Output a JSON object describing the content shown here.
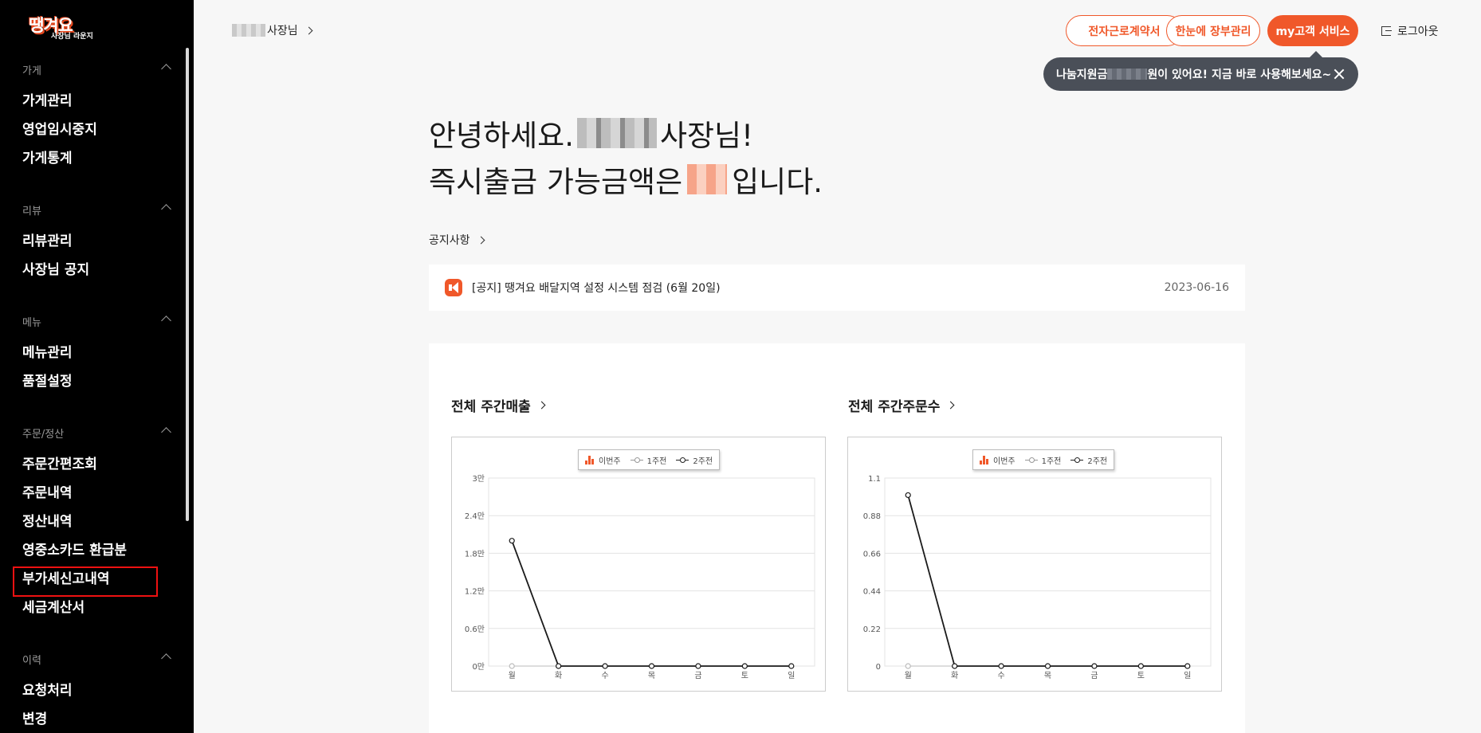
{
  "logo": {
    "main": "땡겨요",
    "sub": "사장님 라운지"
  },
  "sidebar": {
    "sections": [
      {
        "label": "가게",
        "items": [
          "가게관리",
          "영업임시중지",
          "가게통계"
        ]
      },
      {
        "label": "리뷰",
        "items": [
          "리뷰관리",
          "사장님 공지"
        ]
      },
      {
        "label": "메뉴",
        "items": [
          "메뉴관리",
          "품절설정"
        ]
      },
      {
        "label": "주문/정산",
        "items": [
          "주문간편조회",
          "주문내역",
          "정산내역",
          "영중소카드 환급분",
          "부가세신고내역",
          "세금계산서"
        ]
      },
      {
        "label": "이력",
        "items": [
          "요청처리",
          "변경"
        ]
      }
    ]
  },
  "header": {
    "owner_suffix": "사장님",
    "buttons": [
      "전자근로계약서",
      "한눈에 장부관리",
      "my고객 서비스"
    ],
    "logout": "로그아웃",
    "tooltip_prefix": "나눔지원금",
    "tooltip_suffix": "원이 있어요! 지금 바로 사용해보세요~"
  },
  "greeting": {
    "line1_prefix": "안녕하세요.",
    "line1_suffix": "사장님!",
    "line2_prefix": "즉시출금 가능금액은",
    "line2_suffix": "입니다."
  },
  "notice": {
    "link": "공지사항",
    "title": "[공지] 땡겨요 배달지역 설정 시스템 점검 (6월 20일)",
    "date": "2023-06-16"
  },
  "colors": {
    "accent": "#f0582a",
    "sidebar_bg": "#000000",
    "tooltip_bg": "#4a4f58"
  },
  "chart_data": [
    {
      "type": "line",
      "title": "전체 주간매출",
      "categories": [
        "월",
        "화",
        "수",
        "목",
        "금",
        "토",
        "일"
      ],
      "yticks": [
        "0만",
        "0.6만",
        "1.2만",
        "1.8만",
        "2.4만",
        "3만"
      ],
      "ylim": [
        0,
        30000
      ],
      "series": [
        {
          "name": "이번주",
          "kind": "bar",
          "values": [
            0,
            0,
            0,
            0,
            0,
            0,
            0
          ]
        },
        {
          "name": "1주전",
          "kind": "line",
          "values": [
            0,
            0,
            0,
            0,
            0,
            0,
            0
          ]
        },
        {
          "name": "2주전",
          "kind": "line",
          "values": [
            20000,
            0,
            0,
            0,
            0,
            0,
            0
          ]
        }
      ],
      "legend": "top-center",
      "grid": true
    },
    {
      "type": "line",
      "title": "전체 주간주문수",
      "categories": [
        "월",
        "화",
        "수",
        "목",
        "금",
        "토",
        "일"
      ],
      "yticks": [
        "0",
        "0.22",
        "0.44",
        "0.66",
        "0.88",
        "1.1"
      ],
      "ylim": [
        0,
        1.1
      ],
      "series": [
        {
          "name": "이번주",
          "kind": "bar",
          "values": [
            0,
            0,
            0,
            0,
            0,
            0,
            0
          ]
        },
        {
          "name": "1주전",
          "kind": "line",
          "values": [
            0,
            0,
            0,
            0,
            0,
            0,
            0
          ]
        },
        {
          "name": "2주전",
          "kind": "line",
          "values": [
            1,
            0,
            0,
            0,
            0,
            0,
            0
          ]
        }
      ],
      "legend": "top-center",
      "grid": true
    }
  ]
}
